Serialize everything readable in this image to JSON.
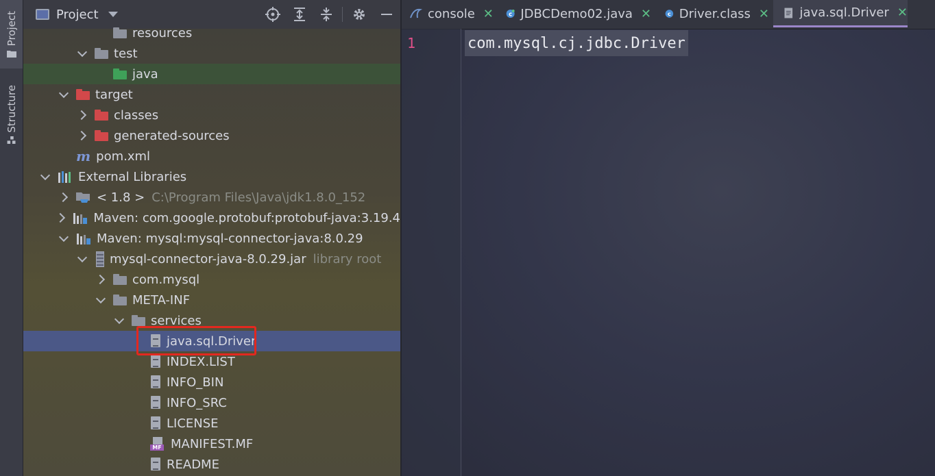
{
  "toolstrip": {
    "project_label": "Project",
    "structure_label": "Structure"
  },
  "project_panel": {
    "title": "Project",
    "tree": [
      {
        "label": "resources",
        "indent": 4,
        "chev": "none",
        "icon": "folder"
      },
      {
        "label": "test",
        "indent": 3,
        "chev": "down",
        "icon": "folder"
      },
      {
        "label": "java",
        "indent": 4,
        "chev": "none",
        "icon": "folder-green"
      },
      {
        "label": "target",
        "indent": 2,
        "chev": "down",
        "icon": "folder-red"
      },
      {
        "label": "classes",
        "indent": 3,
        "chev": "right",
        "icon": "folder-red"
      },
      {
        "label": "generated-sources",
        "indent": 3,
        "chev": "right",
        "icon": "folder-red"
      },
      {
        "label": "pom.xml",
        "indent": 2,
        "chev": "none",
        "icon": "maven-m"
      },
      {
        "label": "External Libraries",
        "indent": 1,
        "chev": "down",
        "icon": "library"
      },
      {
        "label": "< 1.8 >",
        "secondary": "C:\\Program Files\\Java\\jdk1.8.0_152",
        "indent": 2,
        "chev": "right",
        "icon": "jdk"
      },
      {
        "label": "Maven: com.google.protobuf:protobuf-java:3.19.4",
        "indent": 2,
        "chev": "right",
        "icon": "maven-lib"
      },
      {
        "label": "Maven: mysql:mysql-connector-java:8.0.29",
        "indent": 2,
        "chev": "down",
        "icon": "maven-lib"
      },
      {
        "label": "mysql-connector-java-8.0.29.jar",
        "secondary": "library root",
        "indent": 3,
        "chev": "down",
        "icon": "jar"
      },
      {
        "label": "com.mysql",
        "indent": 4,
        "chev": "right",
        "icon": "folder"
      },
      {
        "label": "META-INF",
        "indent": 4,
        "chev": "down",
        "icon": "folder"
      },
      {
        "label": "services",
        "indent": 5,
        "chev": "down",
        "icon": "folder"
      },
      {
        "label": "java.sql.Driver",
        "indent": 6,
        "chev": "none",
        "icon": "file",
        "selected": true
      },
      {
        "label": "INDEX.LIST",
        "indent": 6,
        "chev": "none",
        "icon": "file"
      },
      {
        "label": "INFO_BIN",
        "indent": 6,
        "chev": "none",
        "icon": "file"
      },
      {
        "label": "INFO_SRC",
        "indent": 6,
        "chev": "none",
        "icon": "file"
      },
      {
        "label": "LICENSE",
        "indent": 6,
        "chev": "none",
        "icon": "file"
      },
      {
        "label": "MANIFEST.MF",
        "indent": 6,
        "chev": "none",
        "icon": "manifest"
      },
      {
        "label": "README",
        "indent": 6,
        "chev": "none",
        "icon": "file"
      }
    ]
  },
  "editor": {
    "tabs": [
      {
        "label": "console",
        "icon": "mysql-console-icon",
        "close": "✕"
      },
      {
        "label": "JDBCDemo02.java",
        "icon": "java-class-icon",
        "close": "✕"
      },
      {
        "label": "Driver.class",
        "icon": "class-file-icon",
        "close": "✕"
      },
      {
        "label": "java.sql.Driver",
        "icon": "text-file-icon",
        "close": "✕",
        "active": true
      }
    ],
    "line_number": "1",
    "code": "com.mysql.cj.jdbc.Driver"
  },
  "colors": {
    "selection": "#4b5887",
    "highlight_box": "#e3281f",
    "tab_close": "#5cbf86",
    "line_number": "#e2518a"
  }
}
